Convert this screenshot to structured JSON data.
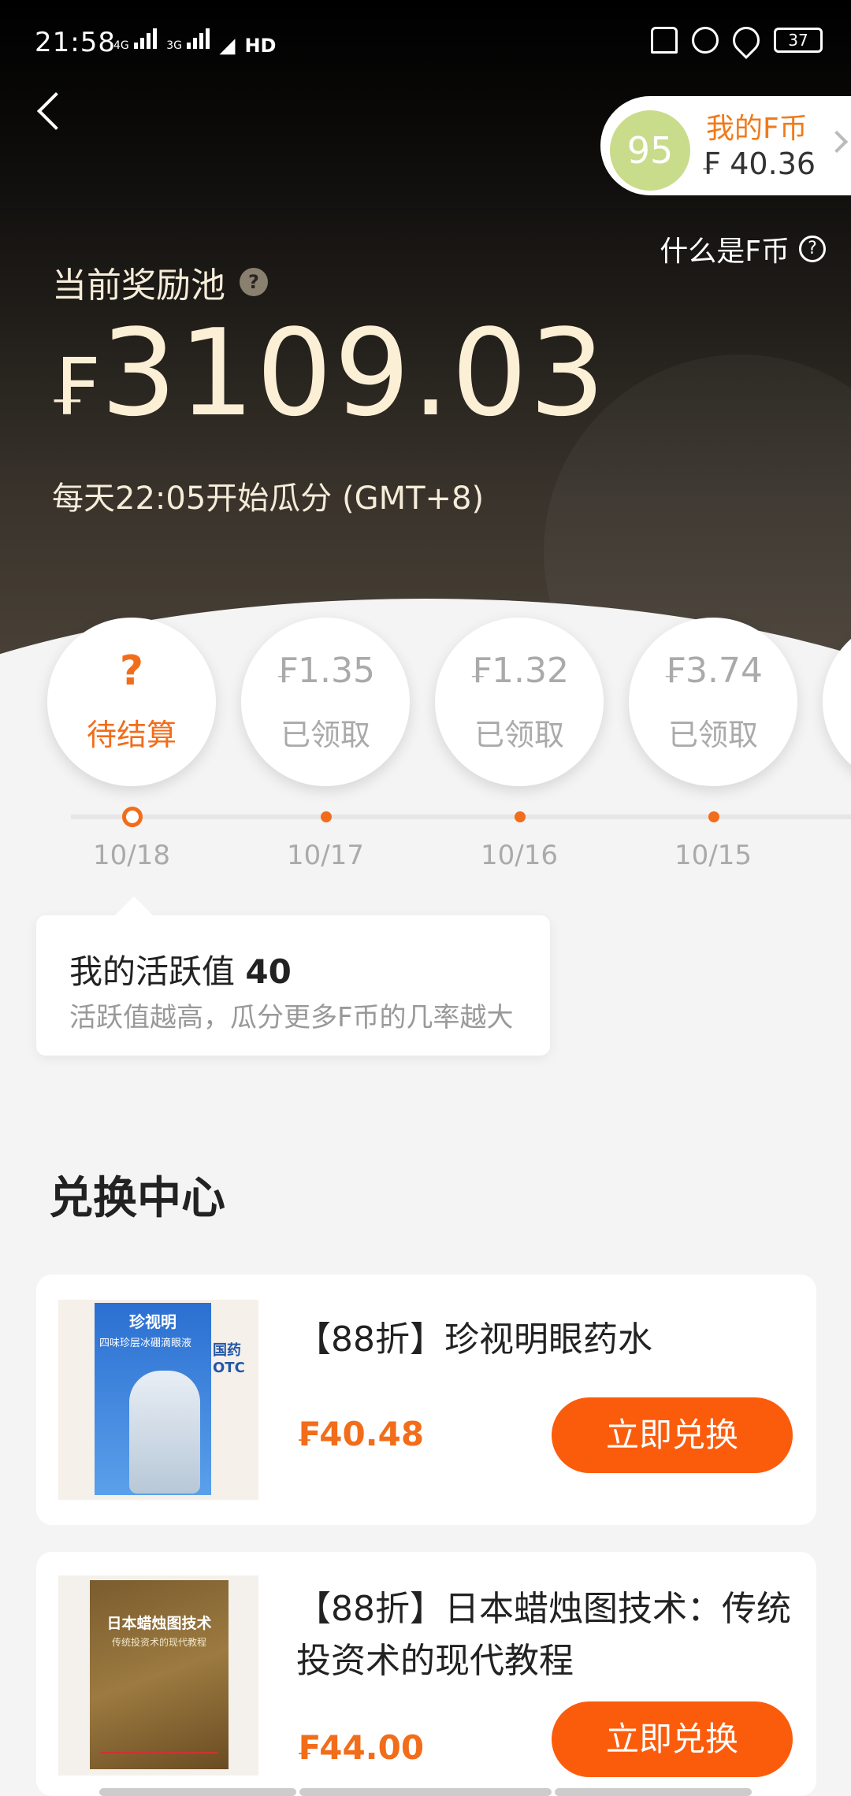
{
  "status_bar": {
    "time": "21:58",
    "network_1": "4G",
    "network_2": "3G",
    "hd": "HD",
    "battery": "37"
  },
  "wallet": {
    "avatar_number": "95",
    "label": "我的F币",
    "amount": "₣ 40.36"
  },
  "what_is_fcoin": "什么是F币",
  "pool": {
    "label": "当前奖励池",
    "currency_symbol": "₣",
    "amount": "3109.03",
    "note": "每天22:05开始瓜分 (GMT+8)"
  },
  "days": [
    {
      "top": "?",
      "bottom": "待结算",
      "date": "10/18",
      "state": "pending"
    },
    {
      "top": "₣1.35",
      "bottom": "已领取",
      "date": "10/17",
      "state": "claimed"
    },
    {
      "top": "₣1.32",
      "bottom": "已领取",
      "date": "10/16",
      "state": "claimed"
    },
    {
      "top": "₣3.74",
      "bottom": "已领取",
      "date": "10/15",
      "state": "claimed"
    }
  ],
  "activity": {
    "label": "我的活跃值",
    "value": "40",
    "hint": "活跃值越高，瓜分更多F币的几率越大"
  },
  "exchange": {
    "title": "兑换中心",
    "products": [
      {
        "name": "【88折】珍视明眼药水",
        "price": "₣40.48",
        "button": "立即兑换",
        "img_brand": "珍视明",
        "img_line": "四味珍层冰硼滴眼液",
        "img_otc": "国药 OTC"
      },
      {
        "name": "【88折】日本蜡烛图技术：传统投资术的现代教程",
        "price": "₣44.00",
        "button": "立即兑换",
        "img_title": "日本蜡烛图技术",
        "img_sub": "传统投资术的现代教程"
      }
    ]
  },
  "colors": {
    "accent": "#f26d1a",
    "button": "#fb5c0c",
    "pool_text": "#fbefd6"
  }
}
